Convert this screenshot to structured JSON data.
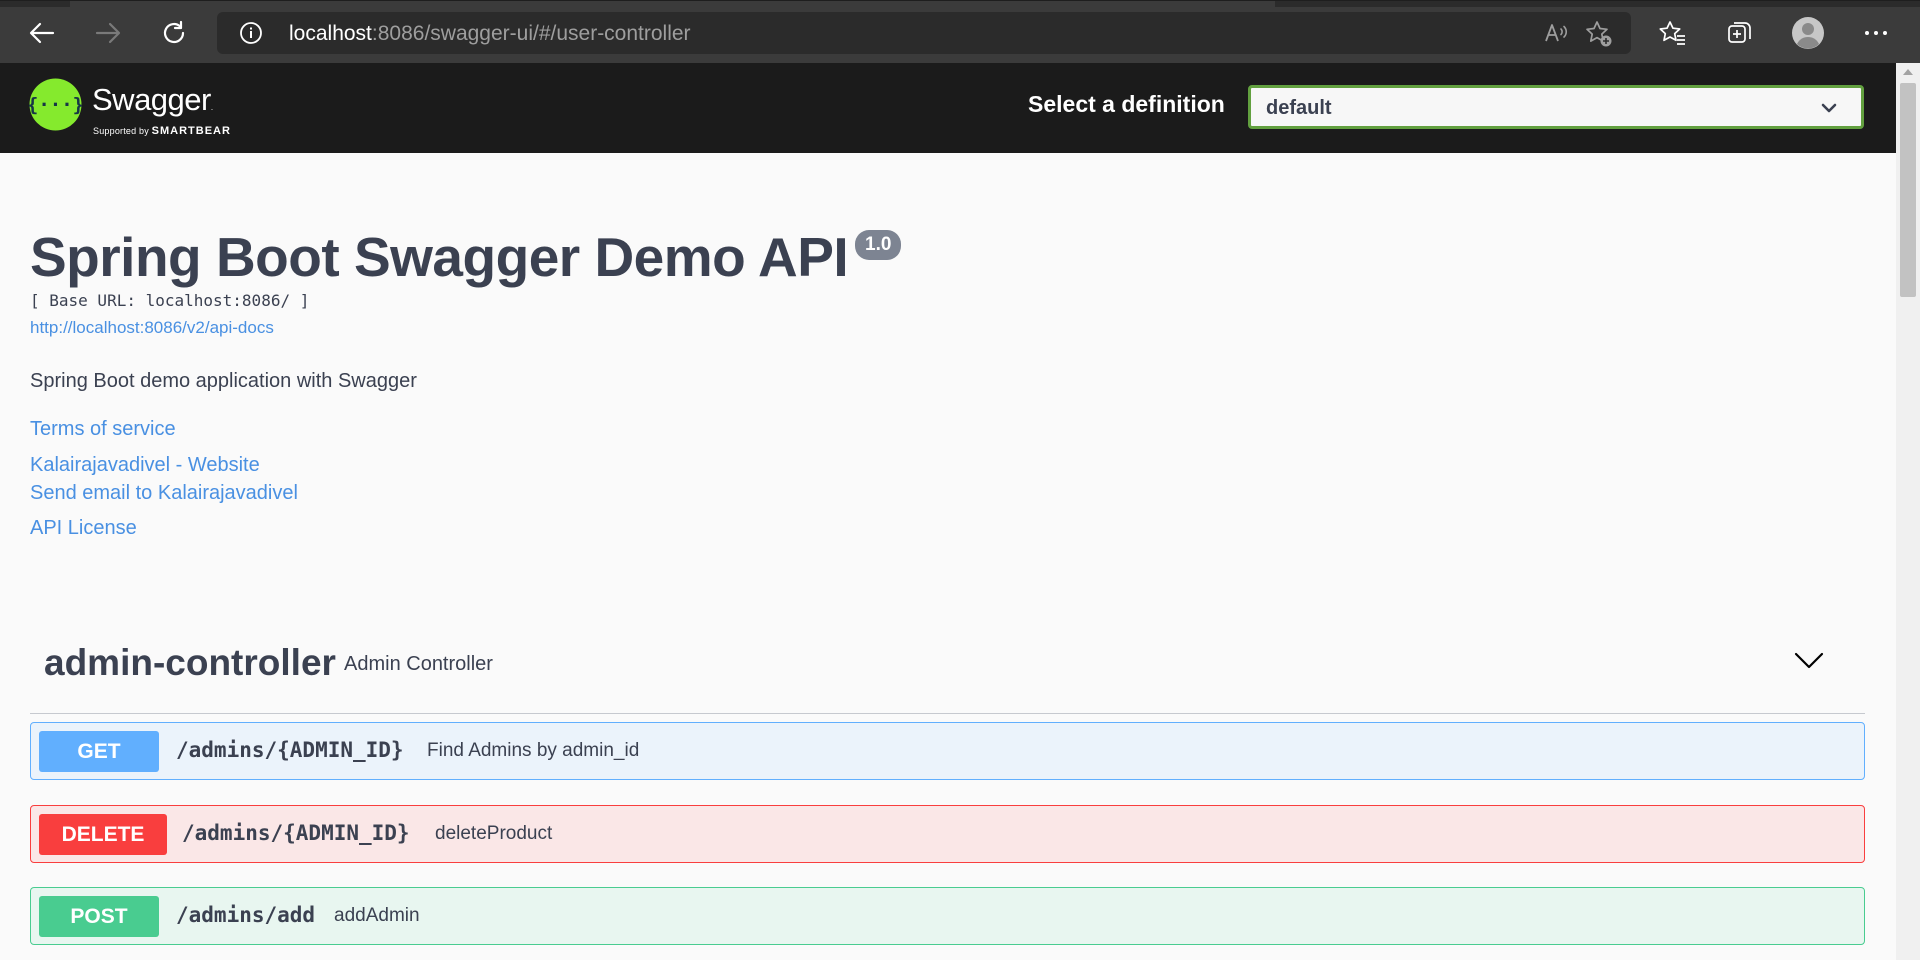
{
  "browser": {
    "url_host": "localhost",
    "url_rest": ":8086/swagger-ui/#/user-controller",
    "icons": [
      "back-icon",
      "forward-icon",
      "reload-icon",
      "info-icon",
      "read-aloud-icon",
      "add-favorite-icon",
      "favorites-icon",
      "collections-icon",
      "profile-icon",
      "more-icon"
    ]
  },
  "header": {
    "brand": "Swagger",
    "brand_tm": ".",
    "supported_by": "Supported by",
    "smartbear": "SMARTBEAR",
    "select_label": "Select a definition",
    "select_value": "default",
    "accent": "#62a03f"
  },
  "info": {
    "title": "Spring Boot Swagger Demo API",
    "version": "1.0",
    "base_url": "[ Base URL: localhost:8086/ ]",
    "api_docs": "http://localhost:8086/v2/api-docs",
    "description": "Spring Boot demo application with Swagger",
    "terms": "Terms of service",
    "website": "Kalairajavadivel - Website",
    "email": "Send email to Kalairajavadivel",
    "license": "API License"
  },
  "controller": {
    "name": "admin-controller",
    "description": "Admin Controller",
    "operations": [
      {
        "method": "GET",
        "path": "/admins/{ADMIN_ID}",
        "summary": "Find Admins by admin_id",
        "color": "#61affe"
      },
      {
        "method": "DELETE",
        "path": "/admins/{ADMIN_ID}",
        "summary": "deleteProduct",
        "color": "#f93e3e"
      },
      {
        "method": "POST",
        "path": "/admins/add",
        "summary": "addAdmin",
        "color": "#49cc90"
      }
    ]
  }
}
